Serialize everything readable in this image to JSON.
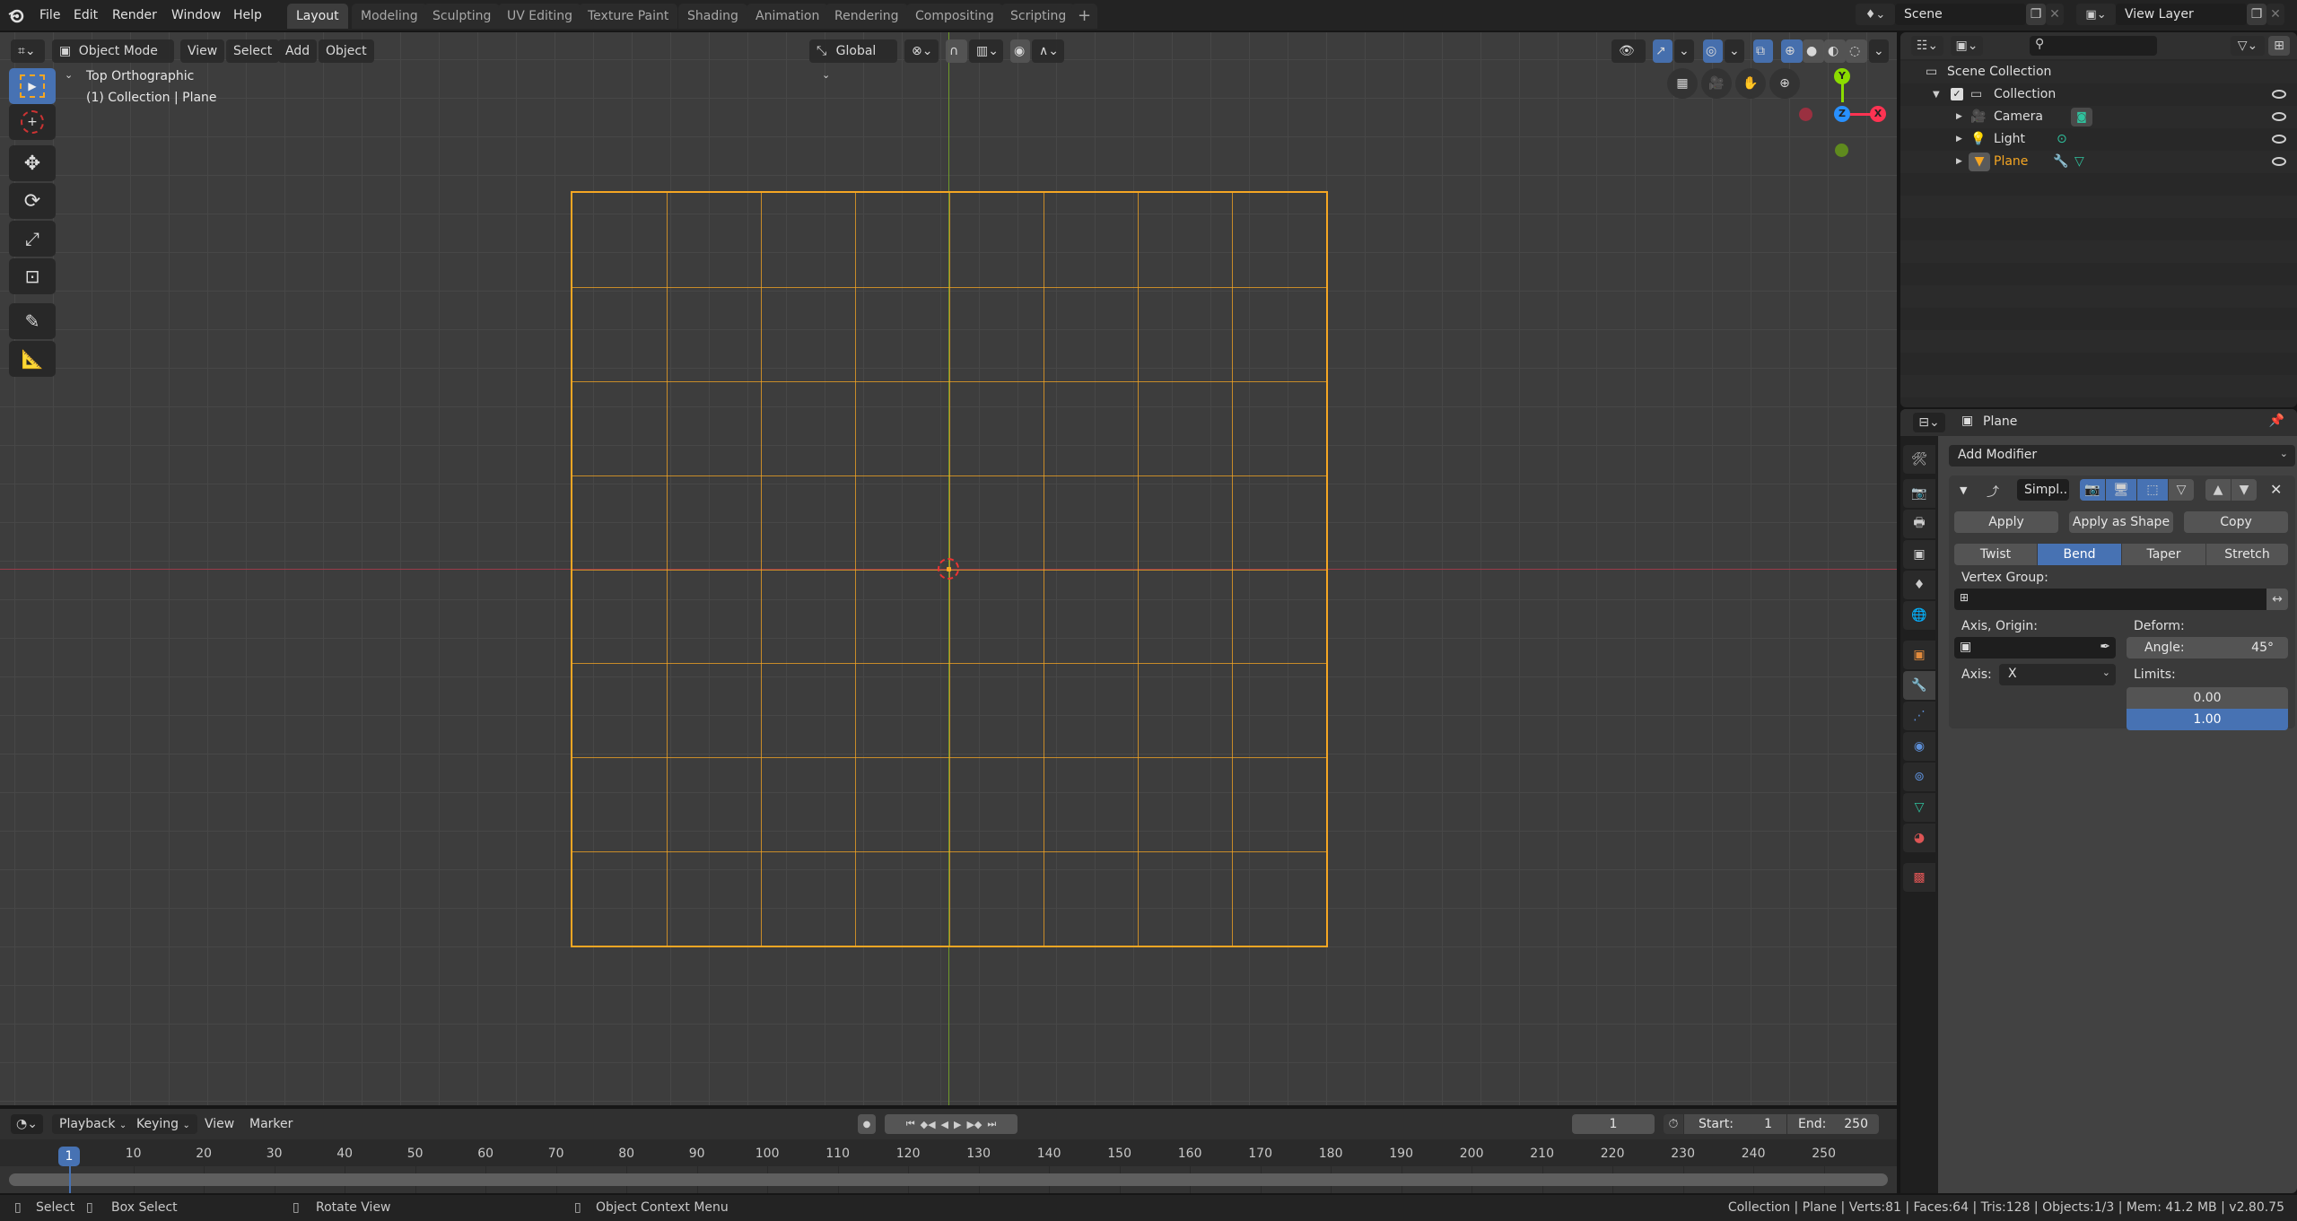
{
  "app": {
    "name": "Blender",
    "version": "v2.80.75"
  },
  "menubar": {
    "items": [
      "File",
      "Edit",
      "Render",
      "Window",
      "Help"
    ]
  },
  "workspaces": {
    "tabs": [
      "Layout",
      "Modeling",
      "Sculpting",
      "UV Editing",
      "Texture Paint",
      "Shading",
      "Animation",
      "Rendering",
      "Compositing",
      "Scripting"
    ],
    "active": "Layout",
    "add_label": "+"
  },
  "scene": {
    "name": "Scene",
    "view_layer": "View Layer"
  },
  "viewport": {
    "mode": "Object Mode",
    "menus": [
      "View",
      "Select",
      "Add",
      "Object"
    ],
    "transform_orientation": "Global",
    "view_name": "Top Orthographic",
    "collection_info": "(1) Collection | Plane",
    "gizmo_axes": {
      "x": "X",
      "y": "Y",
      "z": "Z"
    },
    "colors": {
      "selection": "#f5a623",
      "x_axis": "#ff3352",
      "y_axis": "#8bdc00",
      "z_axis": "#2890ff",
      "active_tool": "#4772b3"
    },
    "plane_subdivisions": 8,
    "tools": [
      "select-box",
      "cursor",
      "move",
      "rotate",
      "scale",
      "transform",
      "annotate",
      "measure"
    ]
  },
  "outliner": {
    "search_placeholder": "",
    "root": "Scene Collection",
    "items": [
      {
        "name": "Collection",
        "level": 1,
        "type": "collection",
        "visible": true,
        "checked": true
      },
      {
        "name": "Camera",
        "level": 2,
        "type": "camera",
        "visible": true
      },
      {
        "name": "Light",
        "level": 2,
        "type": "light",
        "visible": true
      },
      {
        "name": "Plane",
        "level": 2,
        "type": "mesh",
        "visible": true,
        "selected": true
      }
    ]
  },
  "properties": {
    "object_name": "Plane",
    "add_modifier_label": "Add Modifier",
    "modifier": {
      "name": "Simpl..",
      "apply_label": "Apply",
      "apply_shape_label": "Apply as Shape ..",
      "copy_label": "Copy",
      "deform_modes": [
        "Twist",
        "Bend",
        "Taper",
        "Stretch"
      ],
      "active_mode": "Bend",
      "vertex_group_label": "Vertex Group:",
      "vertex_group_value": "",
      "axis_origin_label": "Axis, Origin:",
      "axis_origin_value": "",
      "deform_label": "Deform:",
      "angle_label": "Angle:",
      "angle_value": "45°",
      "axis_label": "Axis:",
      "axis_value": "X",
      "limits_label": "Limits:",
      "limit_low": "0.00",
      "limit_high": "1.00"
    },
    "tabs": [
      "tool",
      "render",
      "output",
      "view-layer",
      "scene",
      "world",
      "object",
      "modifiers",
      "particles",
      "physics",
      "constraints",
      "data",
      "material",
      "texture"
    ],
    "active_tab": "modifiers"
  },
  "timeline": {
    "menus": [
      "Playback",
      "Keying",
      "View",
      "Marker"
    ],
    "current_frame": "1",
    "start_label": "Start:",
    "start_value": "1",
    "end_label": "End:",
    "end_value": "250",
    "ticks": [
      "10",
      "20",
      "30",
      "40",
      "50",
      "60",
      "70",
      "80",
      "90",
      "100",
      "110",
      "120",
      "130",
      "140",
      "150",
      "160",
      "170",
      "180",
      "190",
      "200",
      "210",
      "220",
      "230",
      "240",
      "250"
    ],
    "playhead_label": "1"
  },
  "statusbar": {
    "hints": [
      "Select",
      "Box Select",
      "Rotate View",
      "Object Context Menu"
    ],
    "info": "Collection | Plane | Verts:81 | Faces:64 | Tris:128 | Objects:1/3 | Mem: 41.2 MB | v2.80.75"
  }
}
